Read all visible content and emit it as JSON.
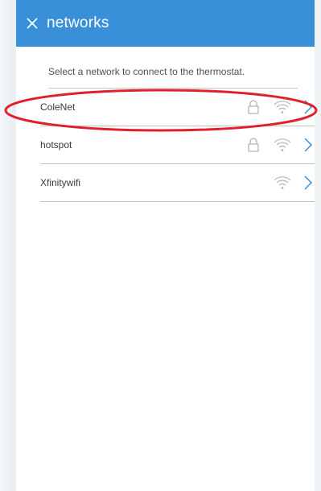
{
  "header": {
    "close_icon": "close-icon",
    "title": "networks",
    "background": "#3a8fd9"
  },
  "prompt": "Select a network to connect to the thermostat.",
  "networks": [
    {
      "name": "ColeNet",
      "secured": true,
      "signal_icon": "wifi-icon",
      "highlighted": true
    },
    {
      "name": "hotspot",
      "secured": true,
      "signal_icon": "wifi-icon",
      "highlighted": false
    },
    {
      "name": "Xfinitywifi",
      "secured": false,
      "signal_icon": "wifi-icon",
      "highlighted": false
    }
  ],
  "colors": {
    "accent": "#3a8fd9",
    "highlight_ring": "#e0202a",
    "icon_gray": "#b5b5b5"
  }
}
